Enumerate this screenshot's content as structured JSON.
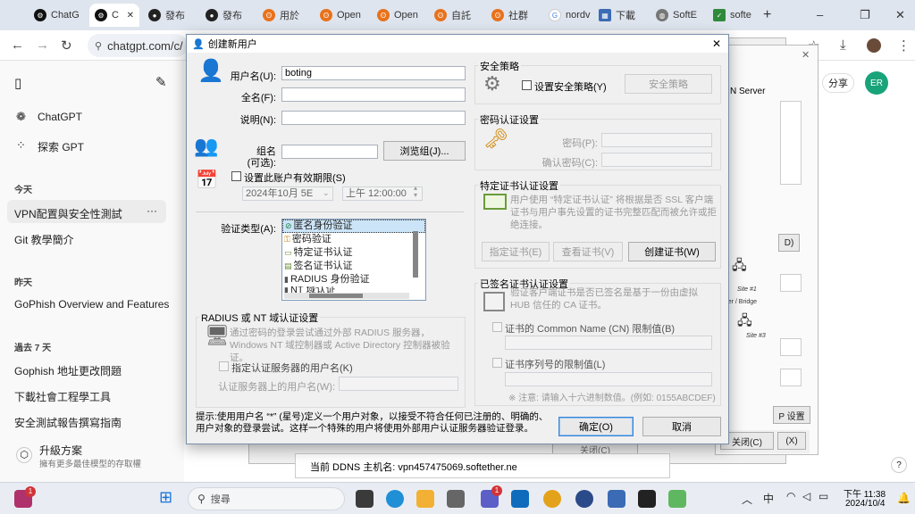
{
  "browser": {
    "tabs": [
      {
        "label": "ChatG",
        "icon": "chatgpt-icon"
      },
      {
        "label": "C",
        "icon": "chatgpt-icon",
        "active": true,
        "close": "✕"
      },
      {
        "label": "發布",
        "icon": "github-icon"
      },
      {
        "label": "發布",
        "icon": "github-icon"
      },
      {
        "label": "用於",
        "icon": "openai-icon"
      },
      {
        "label": "Open",
        "icon": "openai-icon"
      },
      {
        "label": "Open",
        "icon": "openai-icon"
      },
      {
        "label": "自託",
        "icon": "openai-icon"
      },
      {
        "label": "社群",
        "icon": "openai-icon"
      },
      {
        "label": "nordv",
        "icon": "google-icon"
      },
      {
        "label": "下載",
        "icon": "download-site-icon"
      },
      {
        "label": "SoftE",
        "icon": "globe-icon"
      },
      {
        "label": "softe",
        "icon": "softether-icon"
      }
    ],
    "new_tab": "+",
    "url": "chatgpt.com/c/",
    "window_controls": {
      "minimize": "–",
      "maximize": "❐",
      "close": "✕"
    }
  },
  "sidebar": {
    "items": [
      {
        "label": "ChatGPT"
      },
      {
        "label": "探索 GPT"
      }
    ],
    "sections": [
      {
        "header": "今天",
        "items": [
          "VPN配置與安全性測試",
          "Git 教學簡介"
        ]
      },
      {
        "header": "昨天",
        "items": [
          "GoPhish Overview and Features"
        ]
      },
      {
        "header": "過去 7 天",
        "items": [
          "Gophish 地址更改問題",
          "下載社會工程學工具",
          "安全測試報告撰寫指南"
        ]
      }
    ],
    "more": "···",
    "upgrade": {
      "title": "升級方案",
      "subtitle": "擁有更多最佳模型的存取權"
    }
  },
  "chat_header": {
    "share": "分享",
    "avatar": "ER"
  },
  "background_window": {
    "server_text": "N Server",
    "ddns": "当前 DDNS 主机名: vpn457475069.softether.ne",
    "btn_d": "D)",
    "btn_p": "P 设置",
    "btn_close": "关闭(C)",
    "btn_x": "(X)",
    "btn_close2": "关闭(C)",
    "site1": "Site #1",
    "site3": "Site #3",
    "bridge": "erver / Bridge"
  },
  "dialog": {
    "title": "创建新用户",
    "close": "✕",
    "username_label": "用户名(U):",
    "username_value": "boting",
    "fullname_label": "全名(F):",
    "note_label": "说明(N):",
    "group_label_1": "组名",
    "group_label_2": "(可选):",
    "browse_group": "浏览组(J)...",
    "expire_check": "设置此账户有效期限(S)",
    "expire_date": "2024年10月  5E",
    "expire_time": "上午 12:00:00",
    "auth_type_label": "验证类型(A):",
    "auth_types": [
      {
        "label": "匿名身份验证",
        "selected": true
      },
      {
        "label": "密码验证"
      },
      {
        "label": "特定证书认证"
      },
      {
        "label": "签名证书认证"
      },
      {
        "label": "RADIUS 身份验证"
      },
      {
        "label": "NT 域认证"
      }
    ],
    "radius_group": "RADIUS 或 NT 域认证设置",
    "radius_desc": "通过密码的登录尝试通过外部 RADIUS 服务器，Windows NT 域控制器或 Active Directory 控制器被验证。",
    "radius_check": "指定认证服务器的用户名(K)",
    "radius_user_label": "认证服务器上的用户名(W):",
    "security_group": "安全策略",
    "security_check": "设置安全策略(Y)",
    "security_button": "安全策略",
    "password_group": "密码认证设置",
    "password_label": "密码(P):",
    "confirm_label": "确认密码(C):",
    "cert_group": "特定证书认证设置",
    "cert_desc": "用户使用 “特定证书认证” 将根据是否 SSL 客户端证书与用户事先设置的证书完整匹配而被允许或拒绝连接。",
    "cert_specify": "指定证书(E)",
    "cert_view": "查看证书(V)",
    "cert_create": "创建证书(W)",
    "signed_group": "已签名证书认证设置",
    "signed_desc": "验证客户端证书是否已签名是基于一份由虚拟 HUB 信任的 CA 证书。",
    "cn_check": "证书的 Common Name (CN) 限制值(B)",
    "serial_check": "证书序列号的限制值(L)",
    "serial_note": "※ 注意: 请输入十六进制数值。(例如: 0155ABCDEF)",
    "hint": "提示:使用用户名 “*” (星号)定义一个用户对象，以接受不符合任何已注册的、明确的、用户对象的登录尝试。这样一个特殊的用户将使用外部用户认证服务器验证登录。",
    "ok": "确定(O)",
    "cancel": "取消"
  },
  "taskbar": {
    "search_placeholder": "搜尋",
    "time": "下午 11:38",
    "date": "2024/10/4",
    "ime": "中",
    "badge": "1",
    "help": "?"
  }
}
